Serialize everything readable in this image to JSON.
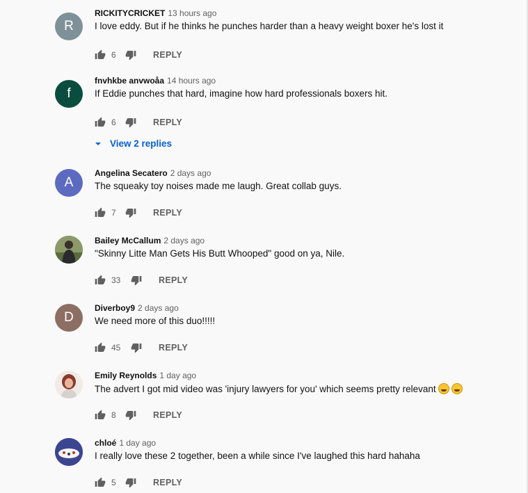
{
  "comments": [
    {
      "author": "RICKITYCRICKET",
      "time": "13 hours ago",
      "text": "I love eddy. But if he thinks he punches harder than a heavy weight boxer he's lost it",
      "likes": "6",
      "avatar_letter": "R",
      "avatar_color": "#7f9198"
    },
    {
      "author": "fnvhkbe anvwoåa",
      "time": "14 hours ago",
      "text": "If Eddie punches that hard, imagine how hard professionals boxers hit.",
      "likes": "6",
      "avatar_letter": "f",
      "avatar_color": "#0a4d3e",
      "replies_label": "View 2 replies"
    },
    {
      "author": "Angelina Secatero",
      "time": "2 days ago",
      "text": "The squeaky toy noises made me laugh. Great collab guys.",
      "likes": "7",
      "avatar_letter": "A",
      "avatar_color": "#5c6bc0"
    },
    {
      "author": "Bailey McCallum",
      "time": "2 days ago",
      "text": "\"Skinny Litte Man Gets His Butt Whooped\" good on ya, Nile.",
      "likes": "33",
      "avatar_image": "photo"
    },
    {
      "author": "Diverboy9",
      "time": "2 days ago",
      "text": "We need more of this duo!!!!!",
      "likes": "45",
      "avatar_letter": "D",
      "avatar_color": "#8d6e63"
    },
    {
      "author": "Emily Reynolds",
      "time": "1 day ago",
      "text": "The advert I got mid video was 'injury lawyers for you' which seems pretty relevant",
      "likes": "8",
      "avatar_image": "photo",
      "emoji": "face-with-tears-of-joy"
    },
    {
      "author": "chloé",
      "time": "1 day ago",
      "text": "I really love these 2 together, been a while since I've laughed this hard hahaha",
      "likes": "5",
      "avatar_image": "photo"
    }
  ],
  "reply_label": "REPLY",
  "icons": {
    "like": "thumbs-up-icon",
    "dislike": "thumbs-down-icon",
    "expand": "caret-down-icon"
  },
  "colors": {
    "background": "#f9f9f9",
    "link": "#065fd4",
    "secondary_text": "#606060"
  }
}
